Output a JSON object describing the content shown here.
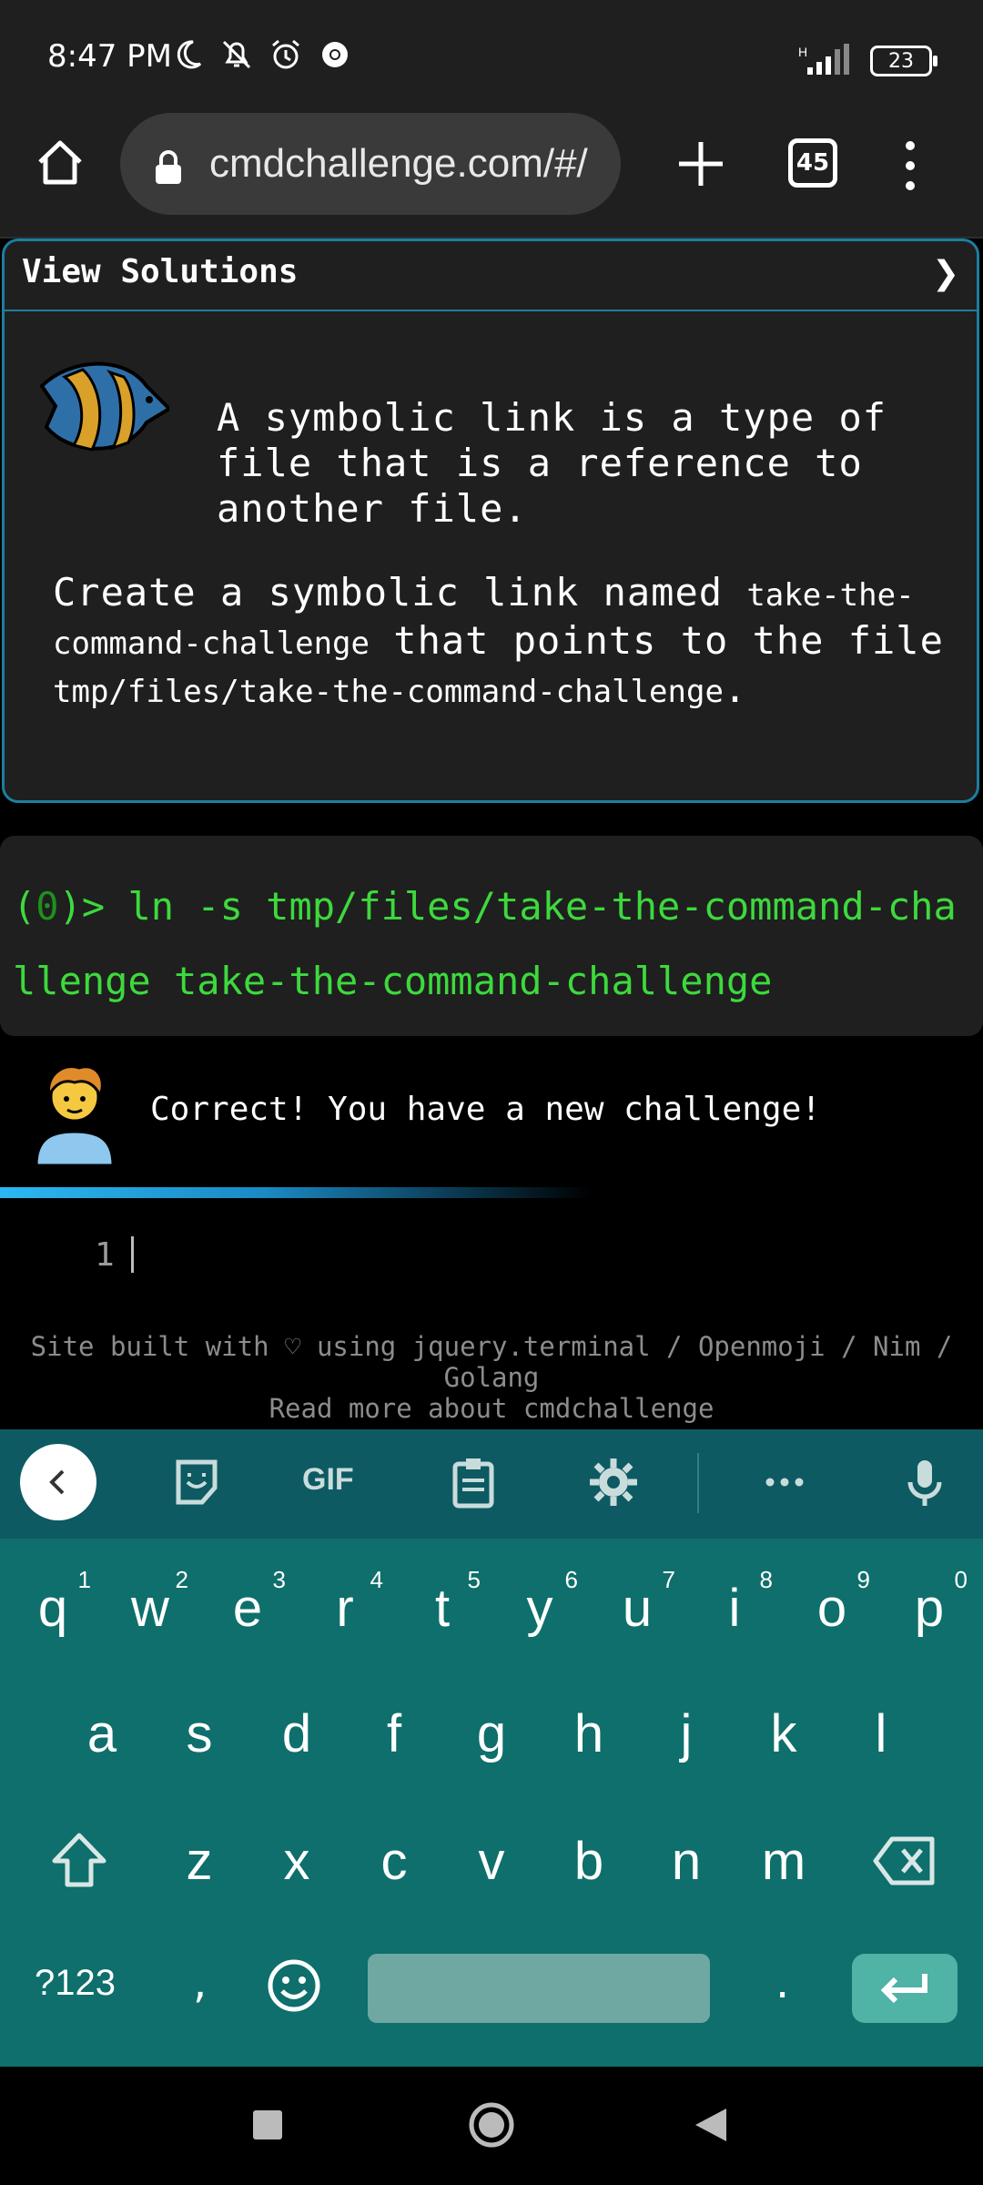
{
  "status": {
    "time": "8:47 PM",
    "battery": "23",
    "network": "H"
  },
  "browser": {
    "url": "cmdchallenge.com/#/",
    "tab_count": "45"
  },
  "panel": {
    "title": "View Solutions",
    "arrow": "❯",
    "definition": "A symbolic link is a type of file that is a reference to another file.",
    "task_pre": "Create a symbolic link named ",
    "task_code1": "take-the-command-challenge",
    "task_mid": " that points to the file ",
    "task_code2": "tmp/files/take-the-command-challenge",
    "task_end": "."
  },
  "terminal": {
    "prompt_open": "(",
    "prompt_status": "0",
    "prompt_close": ")> ",
    "command": "ln -s tmp/files/take-the-command-challenge take-the-command-challenge"
  },
  "result": {
    "message": "Correct! You have a new challenge!"
  },
  "editor": {
    "line_number": "1"
  },
  "footer": {
    "line1": "Site built with ♡ using jquery.terminal / Openmoji / Nim / Golang",
    "line2": "Read more about cmdchallenge"
  },
  "keyboard": {
    "gif_label": "GIF",
    "row1": [
      {
        "k": "q",
        "n": "1"
      },
      {
        "k": "w",
        "n": "2"
      },
      {
        "k": "e",
        "n": "3"
      },
      {
        "k": "r",
        "n": "4"
      },
      {
        "k": "t",
        "n": "5"
      },
      {
        "k": "y",
        "n": "6"
      },
      {
        "k": "u",
        "n": "7"
      },
      {
        "k": "i",
        "n": "8"
      },
      {
        "k": "o",
        "n": "9"
      },
      {
        "k": "p",
        "n": "0"
      }
    ],
    "row2": [
      "a",
      "s",
      "d",
      "f",
      "g",
      "h",
      "j",
      "k",
      "l"
    ],
    "row3": [
      "z",
      "x",
      "c",
      "v",
      "b",
      "n",
      "m"
    ],
    "symbols_label": "?123",
    "comma": ",",
    "period": "."
  },
  "colors": {
    "accent": "#1c7ea0",
    "terminal_green": "#3dd93d",
    "keyboard_bg": "#0e6f6c"
  }
}
